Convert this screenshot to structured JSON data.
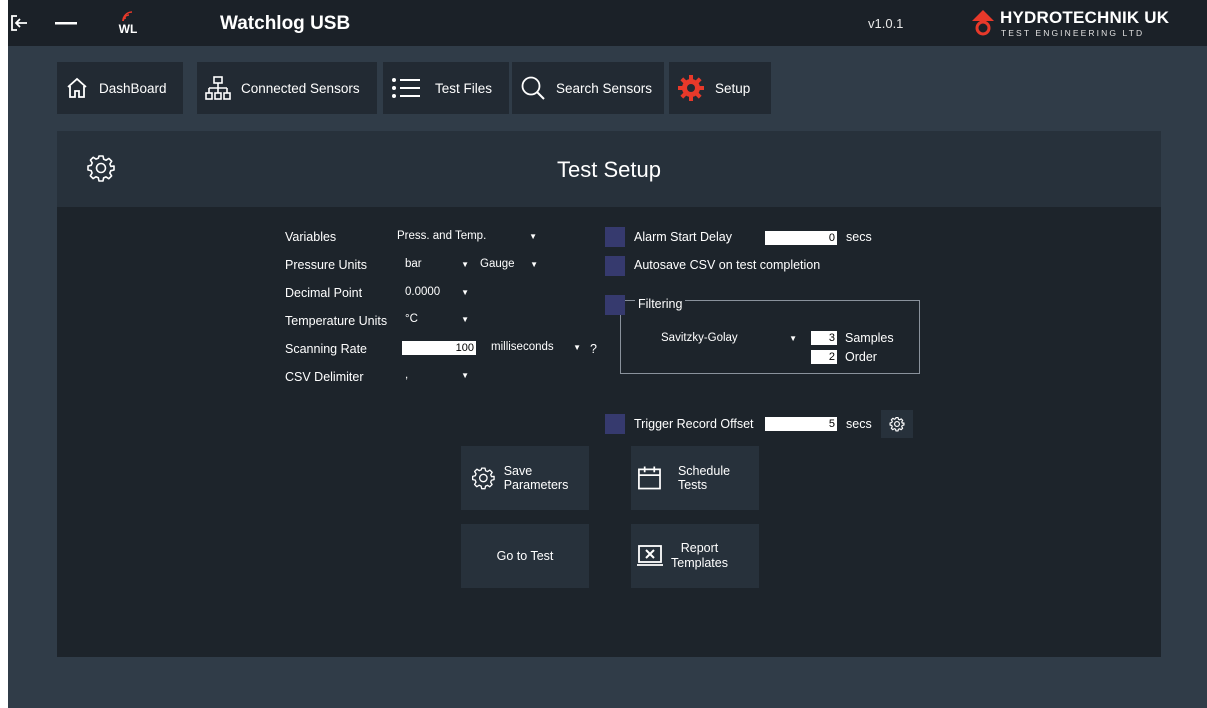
{
  "titlebar": {
    "logo_text": "WL",
    "app_title": "Watchlog USB",
    "version": "v1.0.1",
    "brand_name": "HYDROTECHNIK UK",
    "brand_sub": "TEST ENGINEERING LTD",
    "brand_color": "#e8392a"
  },
  "nav": [
    {
      "label": "DashBoard",
      "icon": "home-icon"
    },
    {
      "label": "Connected Sensors",
      "icon": "network-icon"
    },
    {
      "label": "Test Files",
      "icon": "list-icon"
    },
    {
      "label": "Search Sensors",
      "icon": "search-icon"
    },
    {
      "label": "Setup",
      "icon": "gear-icon"
    }
  ],
  "panel": {
    "title": "Test Setup"
  },
  "form": {
    "variables": {
      "label": "Variables",
      "value": "Press. and Temp."
    },
    "pressure_units": {
      "label": "Pressure Units",
      "value": "bar",
      "mode": "Gauge"
    },
    "decimal_point": {
      "label": "Decimal Point",
      "value": "0.0000"
    },
    "temperature_units": {
      "label": "Temperature Units",
      "value": "°C"
    },
    "scanning_rate": {
      "label": "Scanning Rate",
      "value": "100",
      "unit": "milliseconds",
      "help": "?"
    },
    "csv_delimiter": {
      "label": "CSV Delimiter",
      "value": ","
    }
  },
  "options": {
    "alarm_start_delay": {
      "label": "Alarm Start Delay",
      "value": "0",
      "unit": "secs"
    },
    "autosave": {
      "label": "Autosave CSV on test completion"
    },
    "filtering": {
      "label": "Filtering",
      "method": "Savitzky-Golay",
      "samples_value": "3",
      "samples_label": "Samples",
      "order_value": "2",
      "order_label": "Order"
    },
    "trigger_record_offset": {
      "label": "Trigger Record Offset",
      "value": "5",
      "unit": "secs"
    }
  },
  "actions": {
    "save_parameters": "Save Parameters",
    "schedule_tests": "Schedule Tests",
    "go_to_test": "Go to Test",
    "report_line1": "Report",
    "report_line2": "Templates"
  },
  "colors": {
    "background": "#303c48",
    "titlebar": "#1b2128",
    "panel": "#1d242b",
    "checkbox": "#363a6e",
    "accent": "#e8392a"
  }
}
